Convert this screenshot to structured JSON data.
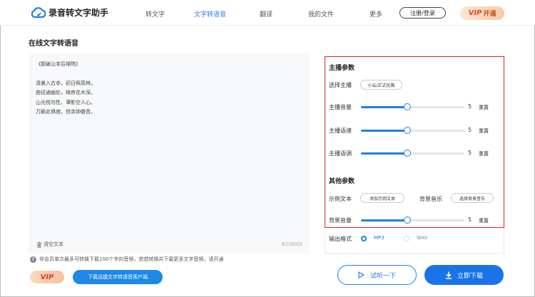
{
  "header": {
    "app_name": "录音转文字助手",
    "nav": [
      "转文字",
      "文字转语音",
      "翻译",
      "我的文件",
      "更多"
    ],
    "active_nav": "文字转语音",
    "login_label": "注册/登录",
    "vip_label": "VIP",
    "vip_action": "开通"
  },
  "page_title": "在线文字转语音",
  "editor": {
    "lines": [
      "《题破山寺后禅院》",
      "清晨入古寺，初日照高林。",
      "曲径通幽处，禅房花木深。",
      "山光悦鸟性，潭影空人心。",
      "万籁此俱寂，但余钟磬音。"
    ],
    "clear_label": "清空文本",
    "counter": "62/3000"
  },
  "notice": "非会员单次最多可转换下载100个字的音频，若想转换并下载更多文字音频，请开通",
  "vip_badge": "VIP",
  "download_client_label": "下载迅捷文字转语音客户端",
  "settings": {
    "anchor_section": "主播参数",
    "select_anchor_label": "选择主播",
    "anchor_value": "小云/正式优雅",
    "sliders": [
      {
        "label": "主播音量",
        "value": 5,
        "fraction": 0.45,
        "reset": "重置"
      },
      {
        "label": "主播语速",
        "value": 5,
        "fraction": 0.45,
        "reset": "重置"
      },
      {
        "label": "主播语调",
        "value": 5,
        "fraction": 0.45,
        "reset": "重置"
      }
    ],
    "other_section": "其他参数",
    "sample_text_label": "示例文本",
    "sample_text_button": "添加示例文本",
    "bg_music_label": "背景音乐",
    "bg_music_button": "选择背景音乐",
    "bg_volume": {
      "label": "背景音量",
      "value": 5,
      "fraction": 0.45,
      "reset": "重置"
    }
  },
  "output": {
    "label": "输出格式",
    "options": [
      "MP3",
      "WAV"
    ],
    "selected": "MP3"
  },
  "buttons": {
    "listen": "试听一下",
    "download": "立即下载"
  },
  "colors": {
    "accent": "#1e7fe8",
    "highlight_border": "#d9232e",
    "vip_red": "#e5432a"
  }
}
